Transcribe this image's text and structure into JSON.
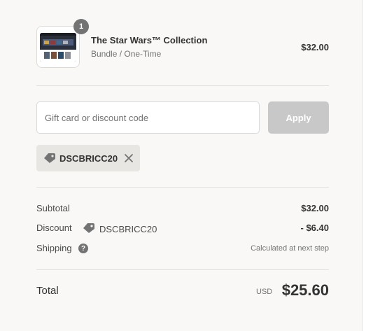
{
  "product": {
    "quantity": "1",
    "title": "The Star Wars™ Collection",
    "subtitle": "Bundle / One-Time",
    "price": "$32.00"
  },
  "discount": {
    "placeholder": "Gift card or discount code",
    "apply_label": "Apply",
    "applied_code": "DSCBRICC20"
  },
  "summary": {
    "subtotal_label": "Subtotal",
    "subtotal_value": "$32.00",
    "discount_label": "Discount",
    "discount_code": "DSCBRICC20",
    "discount_value": "- $6.40",
    "shipping_label": "Shipping",
    "shipping_value": "Calculated at next step",
    "total_label": "Total",
    "currency": "USD",
    "total_value": "$25.60"
  },
  "icons": {
    "tag": "tag-icon",
    "remove": "close-icon",
    "help": "question-circle-icon"
  },
  "colors": {
    "background": "#f9f8f6",
    "apply_disabled": "#c8c8c8",
    "chip_bg": "#e8e6e3",
    "badge": "#737373"
  }
}
